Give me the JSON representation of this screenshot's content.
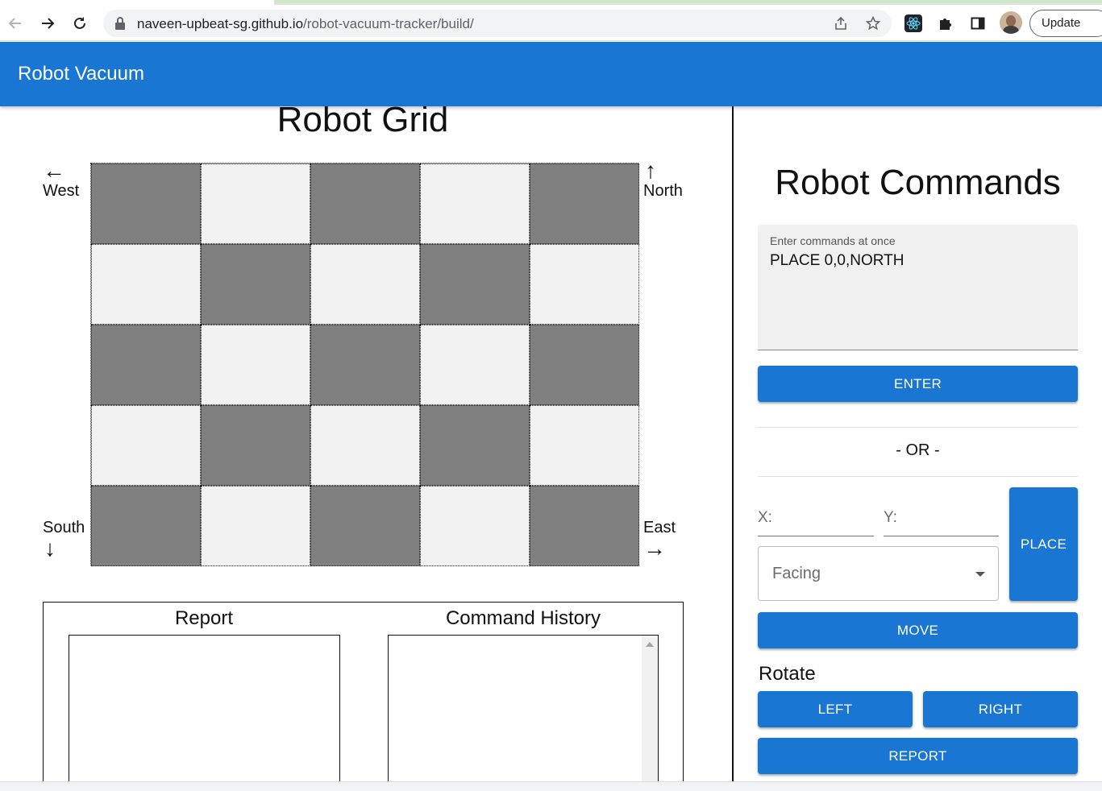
{
  "browser": {
    "url_domain": "naveen-upbeat-sg.github.io",
    "url_path": "/robot-vacuum-tracker/build/",
    "update_label": "Update"
  },
  "appbar": {
    "title": "Robot Vacuum"
  },
  "grid": {
    "title": "Robot Grid",
    "rows": [
      [
        "dark",
        "light",
        "dark",
        "light",
        "dark"
      ],
      [
        "light",
        "dark",
        "light",
        "dark",
        "light"
      ],
      [
        "dark",
        "light",
        "dark",
        "light",
        "dark"
      ],
      [
        "light",
        "dark",
        "light",
        "dark",
        "light"
      ],
      [
        "dark",
        "light",
        "dark",
        "light",
        "dark"
      ]
    ],
    "directions": {
      "west": {
        "label": "West",
        "arrow": "←"
      },
      "north": {
        "label": "North",
        "arrow": "↑"
      },
      "south": {
        "label": "South",
        "arrow": "↓"
      },
      "east": {
        "label": "East",
        "arrow": "→"
      }
    }
  },
  "report_panel": {
    "report_title": "Report",
    "history_title": "Command History"
  },
  "commands": {
    "title": "Robot Commands",
    "textarea_label": "Enter commands at once",
    "textarea_value": "PLACE 0,0,NORTH",
    "enter_label": "ENTER",
    "or_text": "- OR -",
    "x_placeholder": "X:",
    "y_placeholder": "Y:",
    "place_label": "PLACE",
    "facing_placeholder": "Facing",
    "move_label": "MOVE",
    "rotate_label": "Rotate",
    "left_label": "LEFT",
    "right_label": "RIGHT",
    "report_label": "REPORT"
  },
  "colors": {
    "primary": "#1976d2",
    "dark_cell": "#808080",
    "light_cell": "#f2f2f2"
  }
}
